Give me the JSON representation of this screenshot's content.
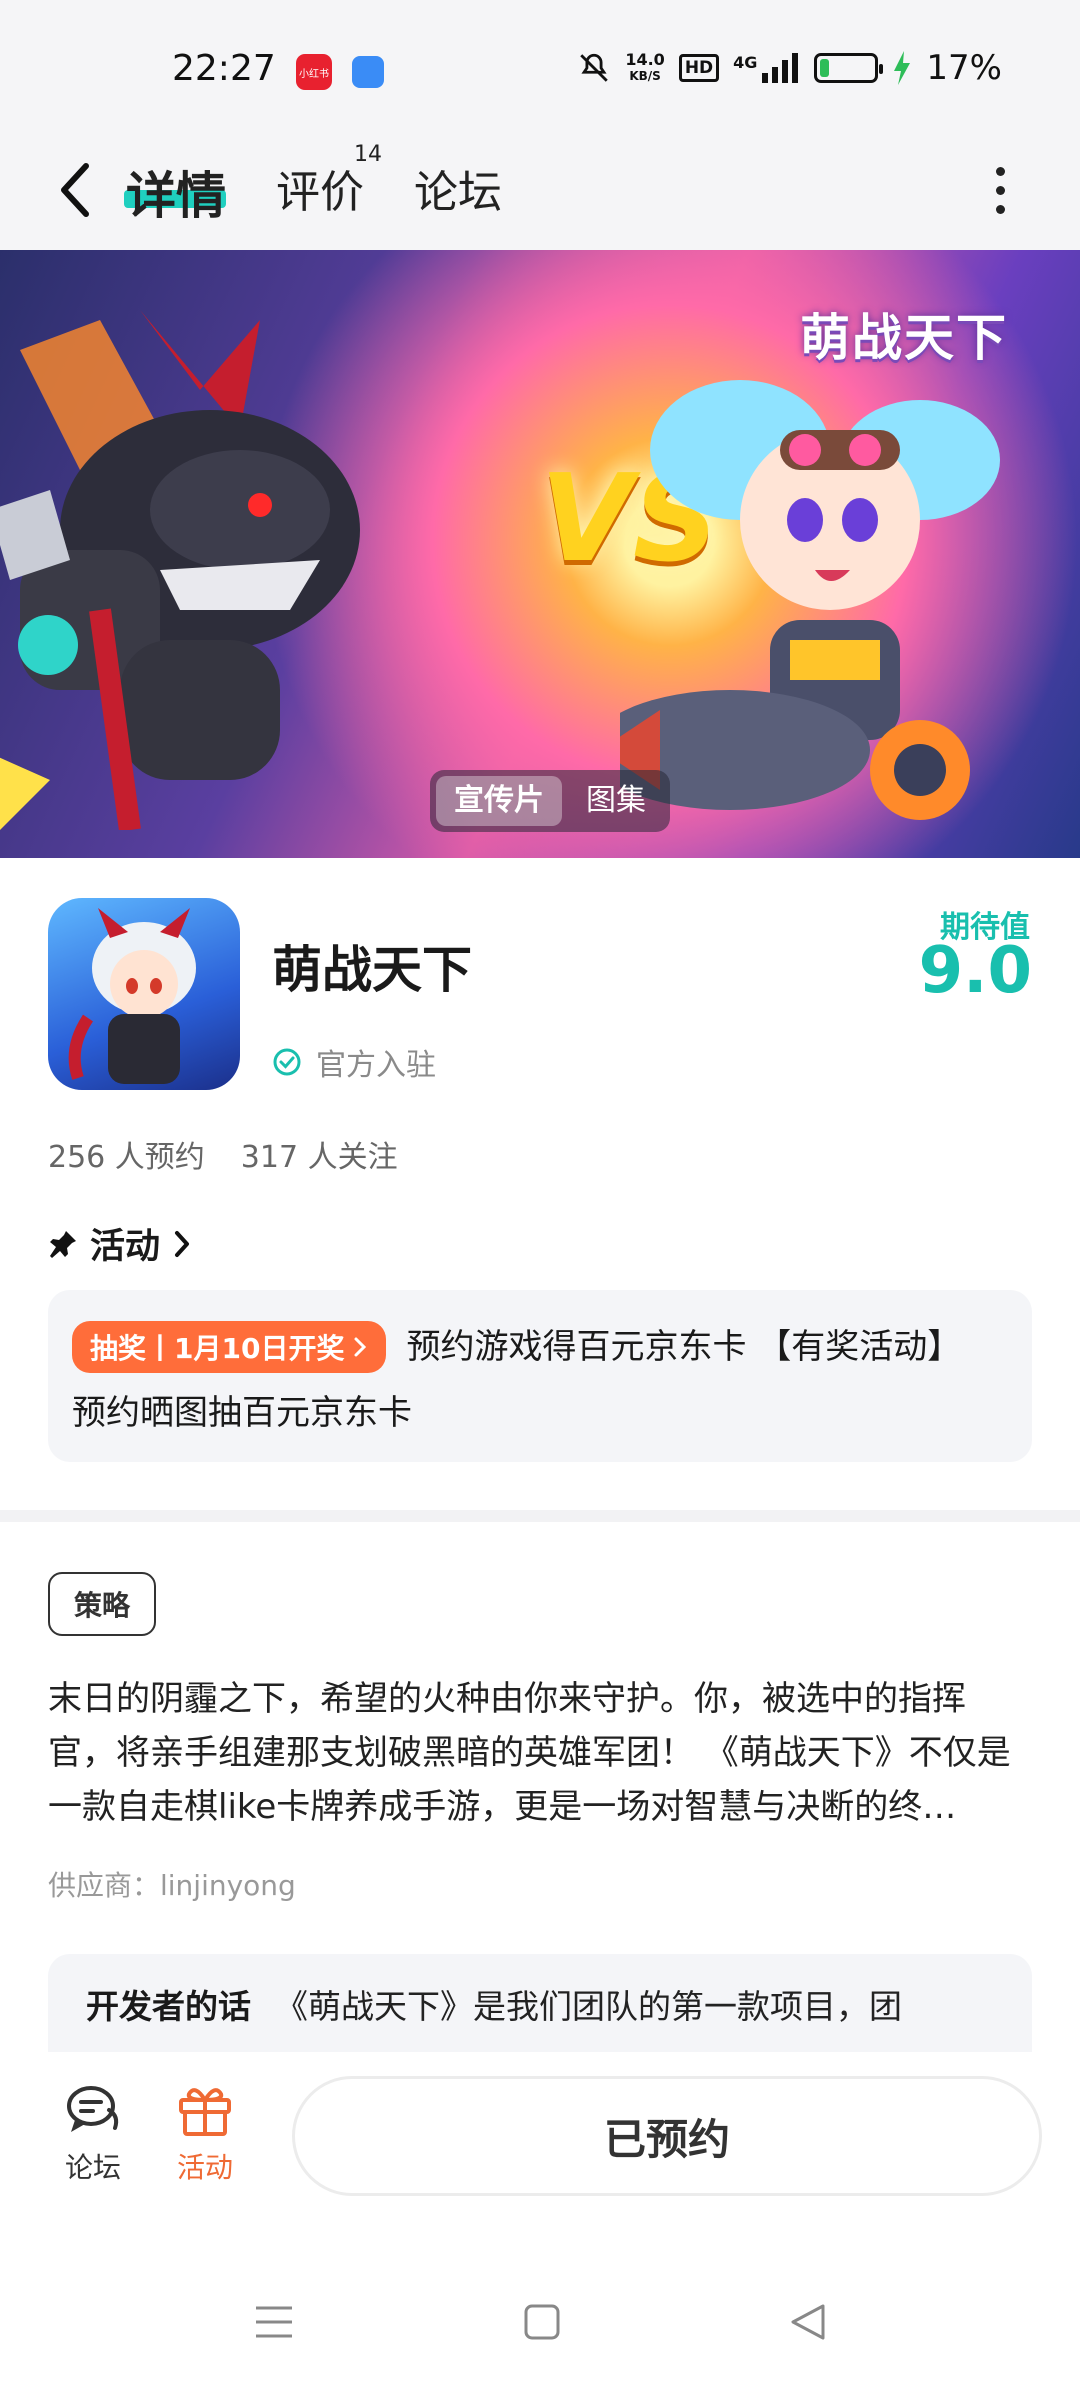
{
  "status_bar": {
    "time": "22:27",
    "app1_label": "小红书",
    "net_speed_value": "14.0",
    "net_speed_unit": "KB/S",
    "hd": "HD",
    "signal": "4G",
    "battery_level": 0.17,
    "battery_text": "17%"
  },
  "nav": {
    "tabs": [
      {
        "label": "详情"
      },
      {
        "label": "评价",
        "badge": "14"
      },
      {
        "label": "论坛"
      }
    ]
  },
  "banner": {
    "title_art": "萌战天下",
    "vs_text": "VS",
    "segments": [
      {
        "label": "宣传片"
      },
      {
        "label": "图集"
      }
    ]
  },
  "app": {
    "name": "萌战天下",
    "official_label": "官方入驻",
    "expect_label": "期待值",
    "expect_score": "9.0",
    "reservations": "256 人预约",
    "followers": "317 人关注"
  },
  "activity": {
    "header": "活动",
    "tag": "抽奖丨1月10日开奖",
    "line1": "预约游戏得百元京东卡 【有奖活动】",
    "line2": "预约晒图抽百元京东卡"
  },
  "description": {
    "tag": "策略",
    "text": "末日的阴霾之下，希望的火种由你来守护。你，被选中的指挥官，将亲手组建那支划破黑暗的英雄军团！ 《萌战天下》不仅是一款自走棋like卡牌养成手游，更是一场对智慧与决断的终…",
    "supplier": "供应商：linjinyong"
  },
  "developer": {
    "title": "开发者的话",
    "text": "《萌战天下》是我们团队的第一款项目，团"
  },
  "bottom_bar": {
    "forum_label": "论坛",
    "activity_label": "活动",
    "reserve_label": "已预约"
  },
  "colors": {
    "accent": "#19bfae",
    "activity_orange": "#ff6d3a",
    "tab_underline": "#1fcfbf"
  }
}
